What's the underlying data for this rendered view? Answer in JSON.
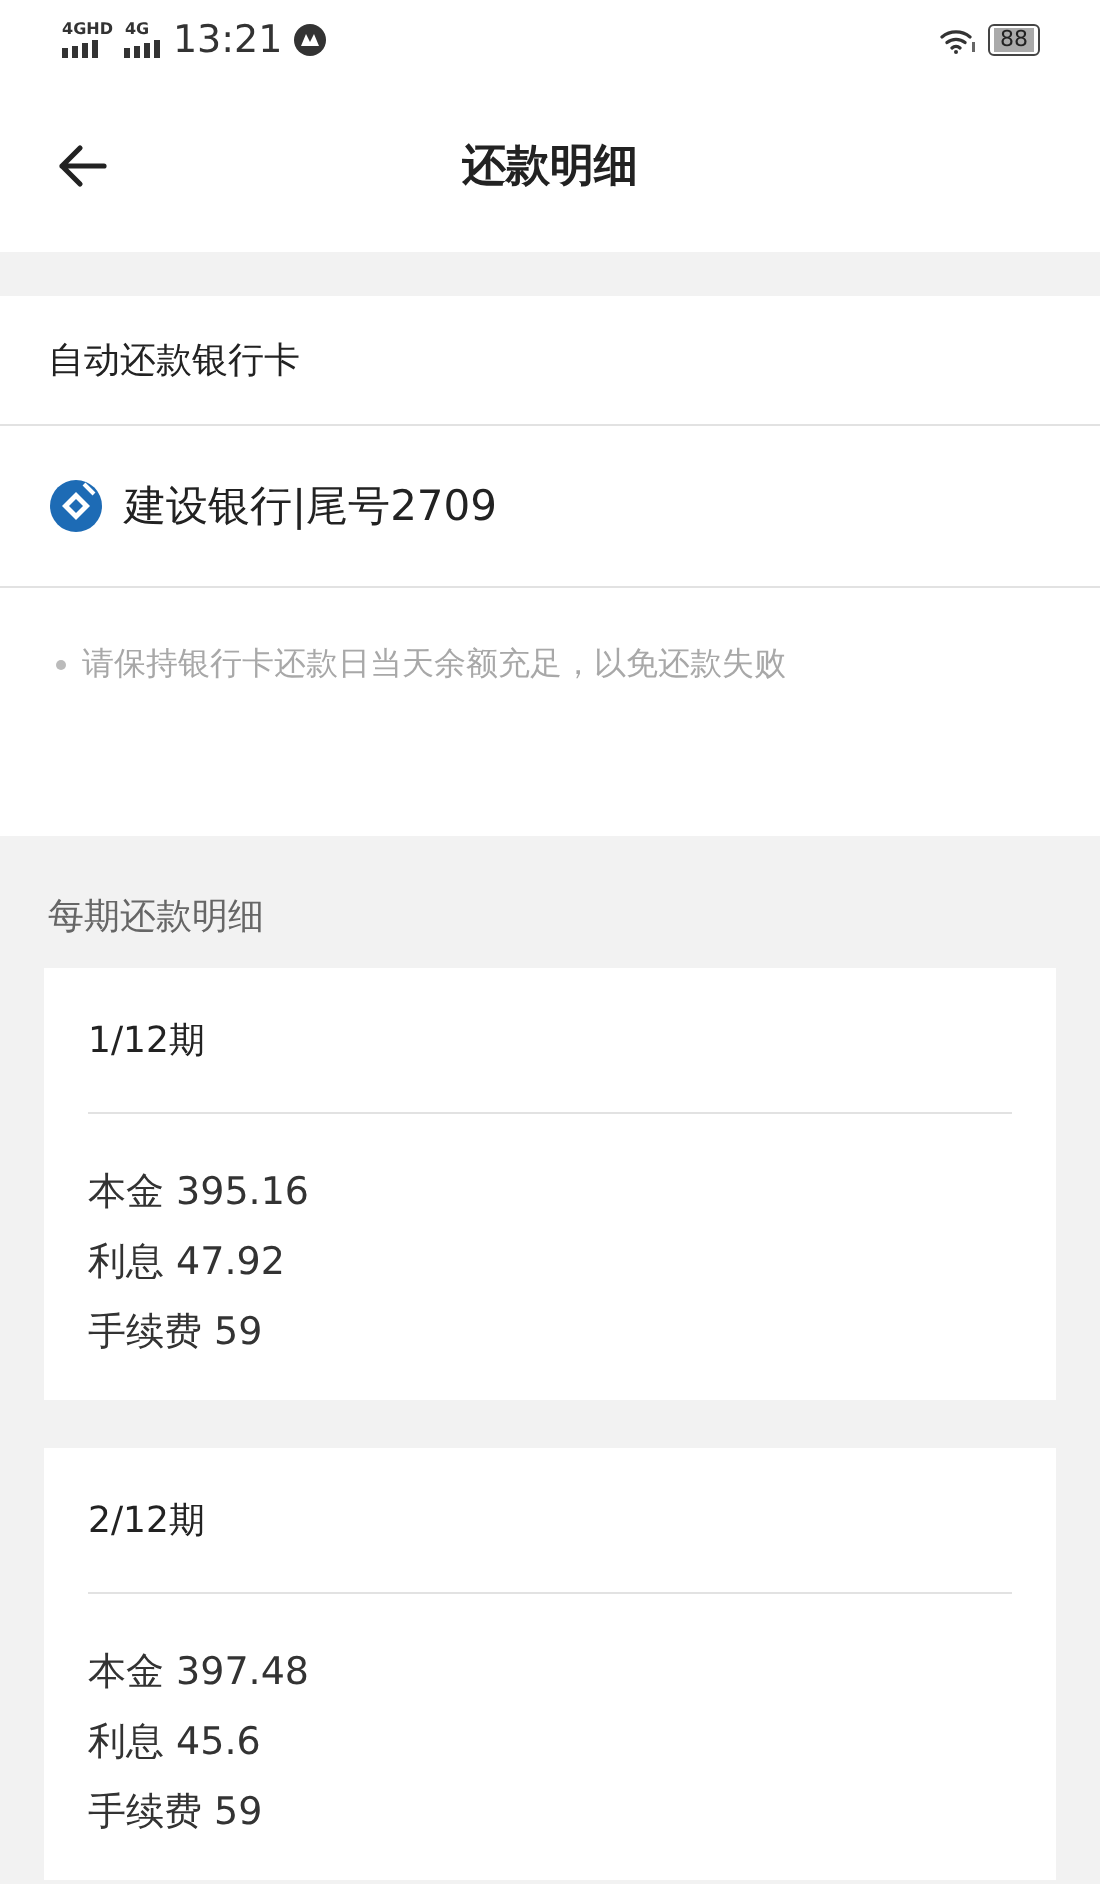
{
  "status_bar": {
    "networks": [
      "4GHD",
      "4G"
    ],
    "time": "13:21",
    "battery": "88"
  },
  "header": {
    "title": "还款明细"
  },
  "auto_repay": {
    "label": "自动还款银行卡",
    "bank": "建设银行|尾号2709",
    "note": "请保持银行卡还款日当天余额充足，以免还款失败"
  },
  "schedule": {
    "title": "每期还款明细",
    "periods": [
      {
        "title": "1/12期",
        "lines": [
          "本金 395.16",
          "利息 47.92",
          "手续费 59"
        ]
      },
      {
        "title": "2/12期",
        "lines": [
          "本金 397.48",
          "利息 45.6",
          "手续费 59"
        ]
      }
    ]
  }
}
